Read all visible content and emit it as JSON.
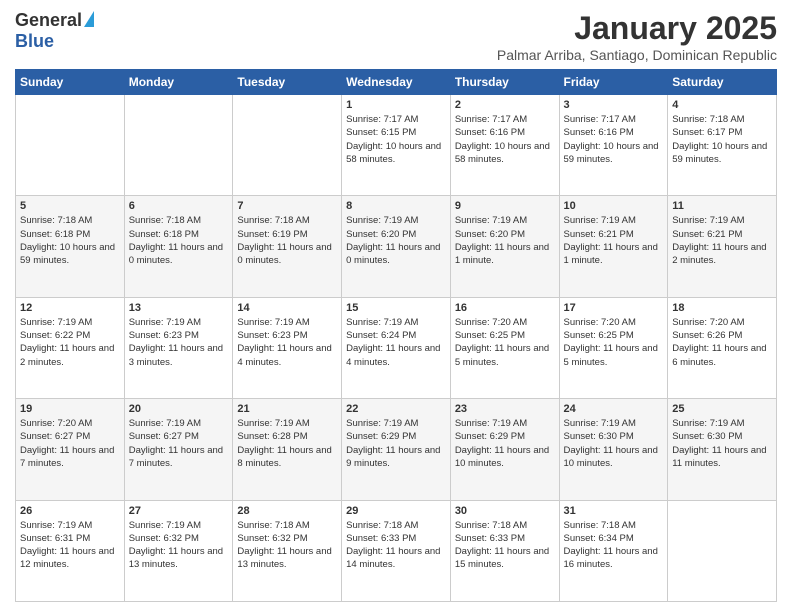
{
  "logo": {
    "general": "General",
    "blue": "Blue"
  },
  "title": "January 2025",
  "subtitle": "Palmar Arriba, Santiago, Dominican Republic",
  "days_of_week": [
    "Sunday",
    "Monday",
    "Tuesday",
    "Wednesday",
    "Thursday",
    "Friday",
    "Saturday"
  ],
  "weeks": [
    [
      {
        "day": "",
        "sunrise": "",
        "sunset": "",
        "daylight": ""
      },
      {
        "day": "",
        "sunrise": "",
        "sunset": "",
        "daylight": ""
      },
      {
        "day": "",
        "sunrise": "",
        "sunset": "",
        "daylight": ""
      },
      {
        "day": "1",
        "sunrise": "Sunrise: 7:17 AM",
        "sunset": "Sunset: 6:15 PM",
        "daylight": "Daylight: 10 hours and 58 minutes."
      },
      {
        "day": "2",
        "sunrise": "Sunrise: 7:17 AM",
        "sunset": "Sunset: 6:16 PM",
        "daylight": "Daylight: 10 hours and 58 minutes."
      },
      {
        "day": "3",
        "sunrise": "Sunrise: 7:17 AM",
        "sunset": "Sunset: 6:16 PM",
        "daylight": "Daylight: 10 hours and 59 minutes."
      },
      {
        "day": "4",
        "sunrise": "Sunrise: 7:18 AM",
        "sunset": "Sunset: 6:17 PM",
        "daylight": "Daylight: 10 hours and 59 minutes."
      }
    ],
    [
      {
        "day": "5",
        "sunrise": "Sunrise: 7:18 AM",
        "sunset": "Sunset: 6:18 PM",
        "daylight": "Daylight: 10 hours and 59 minutes."
      },
      {
        "day": "6",
        "sunrise": "Sunrise: 7:18 AM",
        "sunset": "Sunset: 6:18 PM",
        "daylight": "Daylight: 11 hours and 0 minutes."
      },
      {
        "day": "7",
        "sunrise": "Sunrise: 7:18 AM",
        "sunset": "Sunset: 6:19 PM",
        "daylight": "Daylight: 11 hours and 0 minutes."
      },
      {
        "day": "8",
        "sunrise": "Sunrise: 7:19 AM",
        "sunset": "Sunset: 6:20 PM",
        "daylight": "Daylight: 11 hours and 0 minutes."
      },
      {
        "day": "9",
        "sunrise": "Sunrise: 7:19 AM",
        "sunset": "Sunset: 6:20 PM",
        "daylight": "Daylight: 11 hours and 1 minute."
      },
      {
        "day": "10",
        "sunrise": "Sunrise: 7:19 AM",
        "sunset": "Sunset: 6:21 PM",
        "daylight": "Daylight: 11 hours and 1 minute."
      },
      {
        "day": "11",
        "sunrise": "Sunrise: 7:19 AM",
        "sunset": "Sunset: 6:21 PM",
        "daylight": "Daylight: 11 hours and 2 minutes."
      }
    ],
    [
      {
        "day": "12",
        "sunrise": "Sunrise: 7:19 AM",
        "sunset": "Sunset: 6:22 PM",
        "daylight": "Daylight: 11 hours and 2 minutes."
      },
      {
        "day": "13",
        "sunrise": "Sunrise: 7:19 AM",
        "sunset": "Sunset: 6:23 PM",
        "daylight": "Daylight: 11 hours and 3 minutes."
      },
      {
        "day": "14",
        "sunrise": "Sunrise: 7:19 AM",
        "sunset": "Sunset: 6:23 PM",
        "daylight": "Daylight: 11 hours and 4 minutes."
      },
      {
        "day": "15",
        "sunrise": "Sunrise: 7:19 AM",
        "sunset": "Sunset: 6:24 PM",
        "daylight": "Daylight: 11 hours and 4 minutes."
      },
      {
        "day": "16",
        "sunrise": "Sunrise: 7:20 AM",
        "sunset": "Sunset: 6:25 PM",
        "daylight": "Daylight: 11 hours and 5 minutes."
      },
      {
        "day": "17",
        "sunrise": "Sunrise: 7:20 AM",
        "sunset": "Sunset: 6:25 PM",
        "daylight": "Daylight: 11 hours and 5 minutes."
      },
      {
        "day": "18",
        "sunrise": "Sunrise: 7:20 AM",
        "sunset": "Sunset: 6:26 PM",
        "daylight": "Daylight: 11 hours and 6 minutes."
      }
    ],
    [
      {
        "day": "19",
        "sunrise": "Sunrise: 7:20 AM",
        "sunset": "Sunset: 6:27 PM",
        "daylight": "Daylight: 11 hours and 7 minutes."
      },
      {
        "day": "20",
        "sunrise": "Sunrise: 7:19 AM",
        "sunset": "Sunset: 6:27 PM",
        "daylight": "Daylight: 11 hours and 7 minutes."
      },
      {
        "day": "21",
        "sunrise": "Sunrise: 7:19 AM",
        "sunset": "Sunset: 6:28 PM",
        "daylight": "Daylight: 11 hours and 8 minutes."
      },
      {
        "day": "22",
        "sunrise": "Sunrise: 7:19 AM",
        "sunset": "Sunset: 6:29 PM",
        "daylight": "Daylight: 11 hours and 9 minutes."
      },
      {
        "day": "23",
        "sunrise": "Sunrise: 7:19 AM",
        "sunset": "Sunset: 6:29 PM",
        "daylight": "Daylight: 11 hours and 10 minutes."
      },
      {
        "day": "24",
        "sunrise": "Sunrise: 7:19 AM",
        "sunset": "Sunset: 6:30 PM",
        "daylight": "Daylight: 11 hours and 10 minutes."
      },
      {
        "day": "25",
        "sunrise": "Sunrise: 7:19 AM",
        "sunset": "Sunset: 6:30 PM",
        "daylight": "Daylight: 11 hours and 11 minutes."
      }
    ],
    [
      {
        "day": "26",
        "sunrise": "Sunrise: 7:19 AM",
        "sunset": "Sunset: 6:31 PM",
        "daylight": "Daylight: 11 hours and 12 minutes."
      },
      {
        "day": "27",
        "sunrise": "Sunrise: 7:19 AM",
        "sunset": "Sunset: 6:32 PM",
        "daylight": "Daylight: 11 hours and 13 minutes."
      },
      {
        "day": "28",
        "sunrise": "Sunrise: 7:18 AM",
        "sunset": "Sunset: 6:32 PM",
        "daylight": "Daylight: 11 hours and 13 minutes."
      },
      {
        "day": "29",
        "sunrise": "Sunrise: 7:18 AM",
        "sunset": "Sunset: 6:33 PM",
        "daylight": "Daylight: 11 hours and 14 minutes."
      },
      {
        "day": "30",
        "sunrise": "Sunrise: 7:18 AM",
        "sunset": "Sunset: 6:33 PM",
        "daylight": "Daylight: 11 hours and 15 minutes."
      },
      {
        "day": "31",
        "sunrise": "Sunrise: 7:18 AM",
        "sunset": "Sunset: 6:34 PM",
        "daylight": "Daylight: 11 hours and 16 minutes."
      },
      {
        "day": "",
        "sunrise": "",
        "sunset": "",
        "daylight": ""
      }
    ]
  ]
}
